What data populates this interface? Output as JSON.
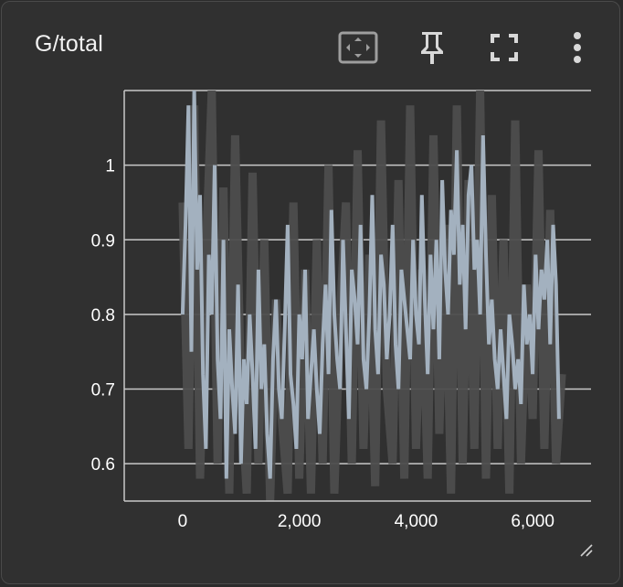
{
  "card": {
    "title": "G/total"
  },
  "toolbar": {
    "fit_icon": "fit-domain-icon",
    "pin_icon": "pin-icon",
    "fullscreen_icon": "fullscreen-icon",
    "more_icon": "more-vert-icon"
  },
  "colors": {
    "background": "#303030",
    "line_smoothed": "#a3b1bf",
    "line_raw": "#4d4d4d",
    "grid": "#c8c8c8",
    "text": "#ffffff"
  },
  "chart_data": {
    "type": "line",
    "title": "",
    "xlabel": "",
    "ylabel": "",
    "xlim": [
      -1000,
      7000
    ],
    "ylim": [
      0.55,
      1.1
    ],
    "x_ticks": [
      0,
      2000,
      4000,
      6000
    ],
    "x_tick_labels": [
      "0",
      "2,000",
      "4,000",
      "6,000"
    ],
    "y_ticks": [
      0.6,
      0.7,
      0.8,
      0.9,
      1.0
    ],
    "y_tick_labels": [
      "0.6",
      "0.7",
      "0.8",
      "0.9",
      "1"
    ],
    "grid": "horizontal",
    "series": [
      {
        "style": "raw",
        "x_start": 0,
        "x_step": 100,
        "values": [
          0.95,
          0.62,
          1.08,
          0.58,
          0.88,
          1.1,
          0.6,
          0.97,
          0.56,
          1.04,
          0.7,
          0.56,
          0.99,
          0.6,
          0.9,
          0.55,
          0.82,
          0.66,
          0.56,
          0.95,
          0.58,
          0.86,
          0.56,
          0.9,
          0.6,
          1.0,
          0.56,
          0.8,
          0.95,
          0.6,
          1.02,
          0.62,
          0.88,
          0.57,
          1.06,
          0.7,
          0.6,
          0.98,
          0.58,
          1.08,
          0.62,
          0.86,
          0.58,
          1.04,
          0.64,
          0.92,
          0.56,
          1.08,
          0.6,
          0.98,
          0.62,
          1.1,
          0.58,
          0.96,
          0.62,
          0.9,
          0.56,
          1.06,
          0.6,
          0.84,
          0.66,
          1.02,
          0.62,
          0.94,
          0.6,
          0.72
        ]
      },
      {
        "style": "smoothed",
        "x_start": 0,
        "x_step": 50,
        "values": [
          0.8,
          0.92,
          1.08,
          0.75,
          1.1,
          0.86,
          0.96,
          0.72,
          0.62,
          0.88,
          0.8,
          1.0,
          0.74,
          0.66,
          0.9,
          0.58,
          0.78,
          0.7,
          0.64,
          0.84,
          0.6,
          0.74,
          0.68,
          0.8,
          0.72,
          0.62,
          0.86,
          0.7,
          0.76,
          0.64,
          0.58,
          0.74,
          0.82,
          0.7,
          0.66,
          0.78,
          0.92,
          0.72,
          0.68,
          0.62,
          0.8,
          0.74,
          0.86,
          0.66,
          0.72,
          0.78,
          0.7,
          0.64,
          0.76,
          0.84,
          0.72,
          0.94,
          0.8,
          0.74,
          0.7,
          0.9,
          0.78,
          0.66,
          0.86,
          0.82,
          0.76,
          0.92,
          0.74,
          0.7,
          0.8,
          0.96,
          0.78,
          0.72,
          0.88,
          0.84,
          0.74,
          0.8,
          0.92,
          0.76,
          0.7,
          0.86,
          0.82,
          0.78,
          0.74,
          0.9,
          0.8,
          0.76,
          0.96,
          0.82,
          0.72,
          0.88,
          0.78,
          0.9,
          0.74,
          0.98,
          0.86,
          0.8,
          0.94,
          0.88,
          1.02,
          0.84,
          0.92,
          0.78,
          0.96,
          1.0,
          0.86,
          0.9,
          0.8,
          1.04,
          0.88,
          0.76,
          0.82,
          0.74,
          0.7,
          0.78,
          0.72,
          0.66,
          0.8,
          0.76,
          0.7,
          0.74,
          0.68,
          0.84,
          0.76,
          0.8,
          0.72,
          0.88,
          0.78,
          0.86,
          0.82,
          0.9,
          0.76,
          0.92,
          0.84,
          0.66
        ]
      }
    ]
  }
}
